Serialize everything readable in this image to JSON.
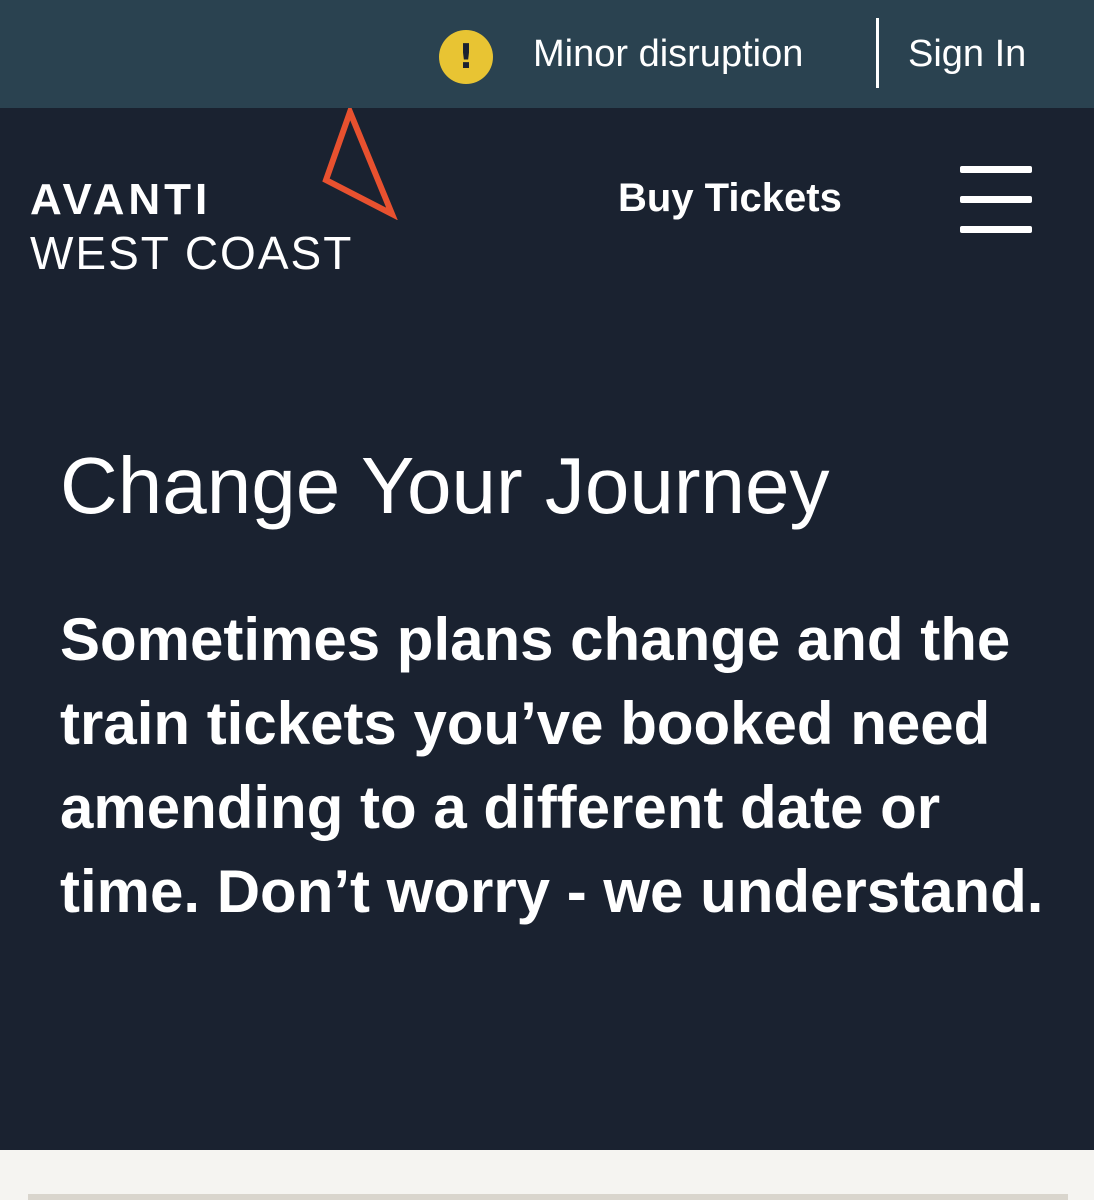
{
  "topbar": {
    "alert_icon": "exclamation-circle-icon",
    "alert_glyph": "!",
    "disruption_label": "Minor disruption",
    "signin_label": "Sign In",
    "colors": {
      "background": "#2a4250",
      "alert": "#e8c433"
    }
  },
  "header": {
    "logo_line1": "AVANTI",
    "logo_line2": "WEST COAST",
    "logo_mark_icon": "triangle-logo-icon",
    "logo_mark_color": "#e8512f",
    "buy_tickets_label": "Buy Tickets",
    "menu_icon": "hamburger-menu-icon"
  },
  "hero": {
    "title": "Change Your Journey",
    "intro": "Sometimes plans change and the train tickets you’ve booked need amending to a different date or time. Don’t worry - we understand.",
    "background": "#1a2230"
  }
}
